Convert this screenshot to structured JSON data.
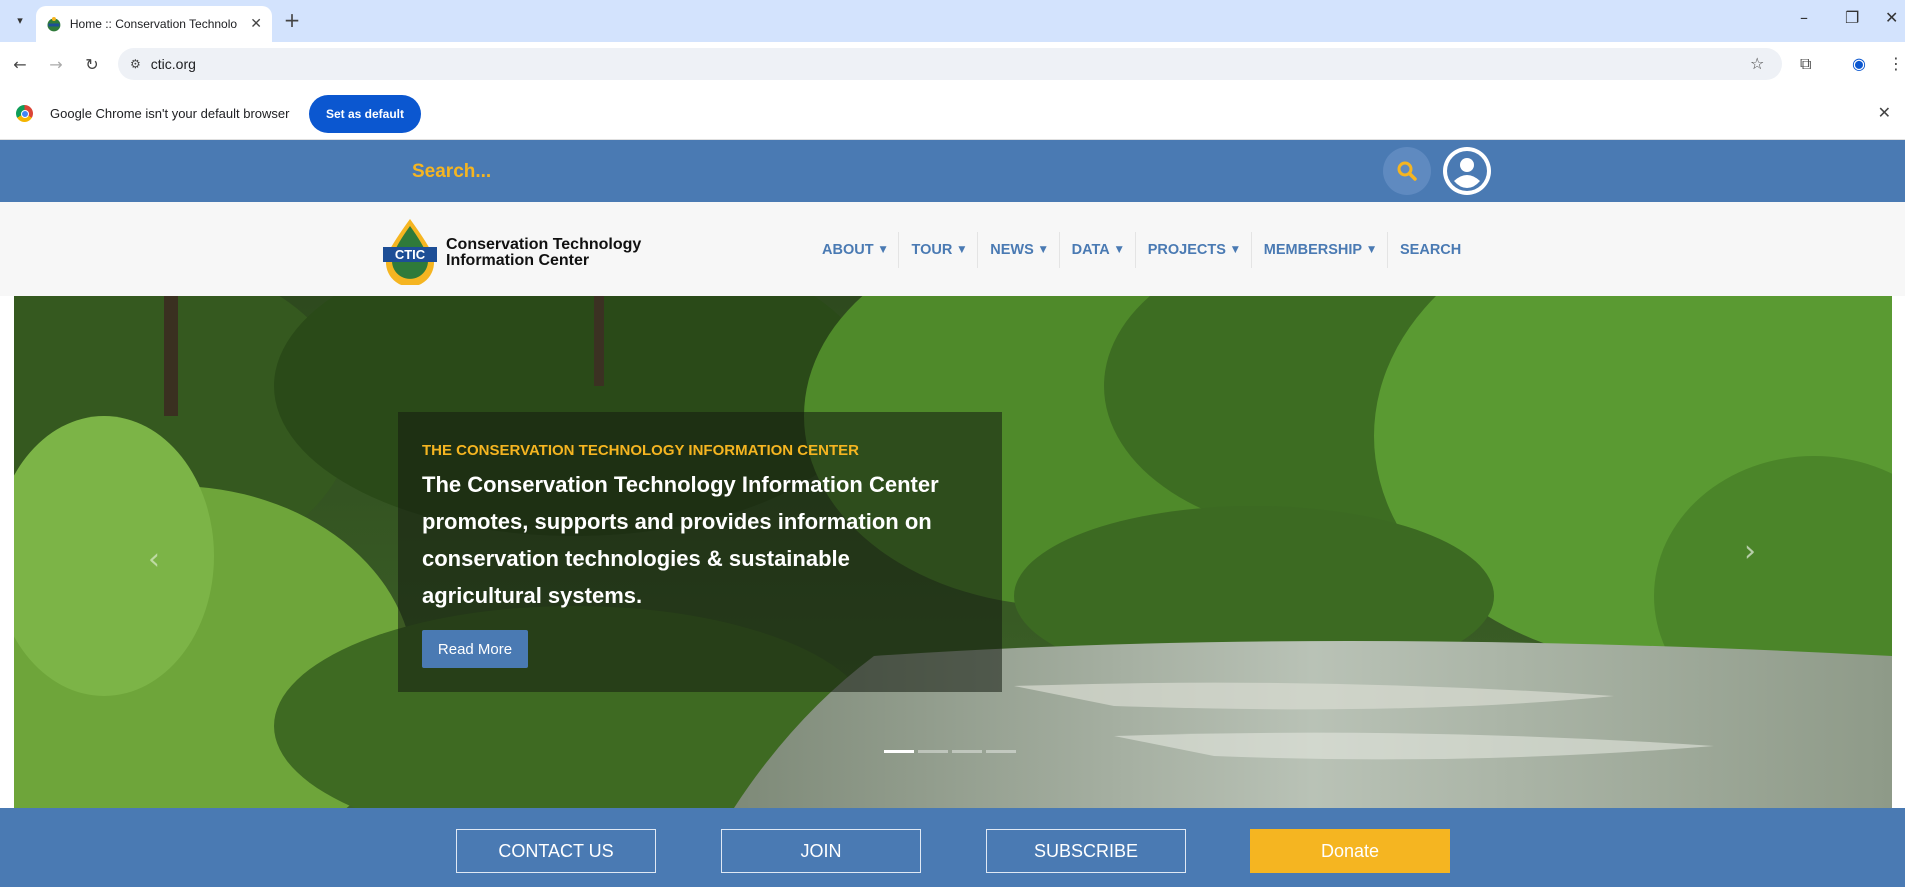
{
  "browser": {
    "tab_title": "Home :: Conservation Technolo",
    "url": "ctic.org",
    "infobar_message": "Google Chrome isn't your default browser",
    "set_default_label": "Set as default"
  },
  "site": {
    "search_placeholder": "Search...",
    "brand_line1": "Conservation Technology",
    "brand_line2": "Information Center",
    "logo_text": "CTIC",
    "nav": [
      {
        "label": "ABOUT"
      },
      {
        "label": "TOUR"
      },
      {
        "label": "NEWS"
      },
      {
        "label": "DATA"
      },
      {
        "label": "PROJECTS"
      },
      {
        "label": "MEMBERSHIP"
      },
      {
        "label": "SEARCH"
      }
    ],
    "colors": {
      "primary_blue": "#4a7ab3",
      "accent_gold": "#f5b521"
    }
  },
  "hero": {
    "eyebrow": "THE CONSERVATION TECHNOLOGY INFORMATION CENTER",
    "text": "The Conservation Technology Information Center promotes, supports and provides information on conservation technologies & sustainable agricultural systems.",
    "button": "Read More",
    "slides": 4,
    "active_slide": 1
  },
  "footer_buttons": {
    "contact": "CONTACT US",
    "join": "JOIN",
    "subscribe": "SUBSCRIBE",
    "donate": "Donate"
  }
}
